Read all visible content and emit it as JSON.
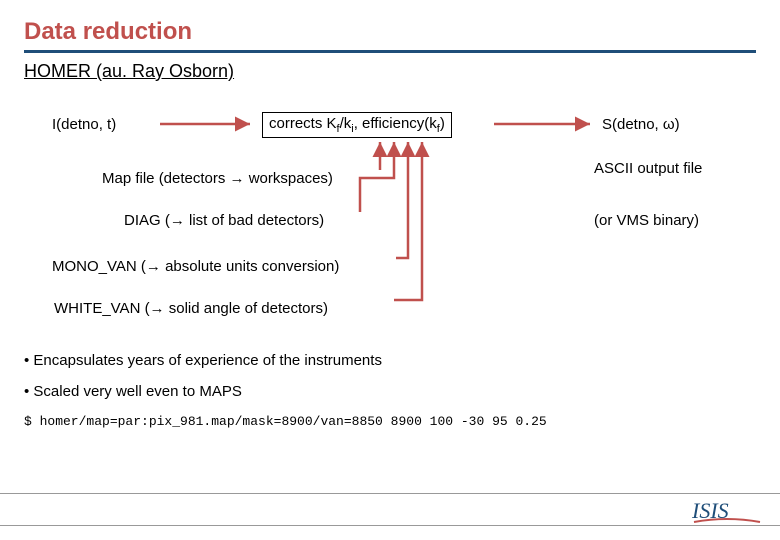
{
  "title": "Data reduction",
  "subtitle": "HOMER (au. Ray Osborn)",
  "flow": {
    "input": "I(detno, t)",
    "corrects_prefix": "corrects K",
    "corrects_mid": "/k",
    "corrects_suffix": ", efficiency(k",
    "corrects_end": ")",
    "output_prefix": "S(detno, ",
    "output_omega": "ω",
    "output_end": ")"
  },
  "steps": {
    "map": "Map file (detectors → workspaces)",
    "diag": "DIAG (→ list of bad detectors)",
    "mono": "MONO_VAN (→ absolute units conversion)",
    "white": "WHITE_VAN (→ solid angle of detectors)"
  },
  "notes": {
    "ascii": "ASCII output file",
    "vms": "(or VMS binary)"
  },
  "bullets": {
    "b1": "Encapsulates years of experience of the instruments",
    "b2": "Scaled very well even to MAPS"
  },
  "command": "$ homer/map=par:pix_981.map/mask=8900/van=8850 8900 100 -30 95 0.25",
  "logo": "ISIS"
}
